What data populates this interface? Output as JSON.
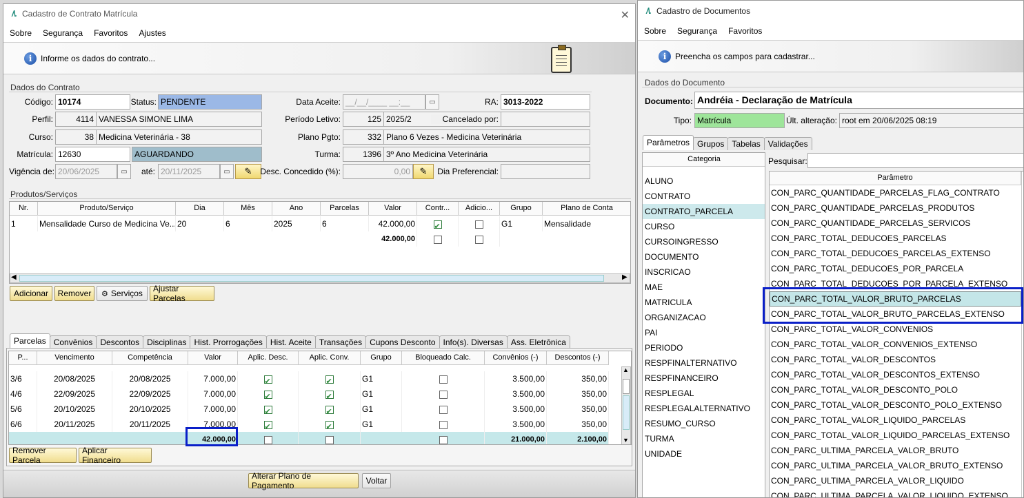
{
  "left_window": {
    "title": "Cadastro de Contrato Matrícula",
    "menu": [
      "Sobre",
      "Segurança",
      "Favoritos",
      "Ajustes"
    ],
    "banner_text": "Informe os dados do contrato...",
    "section_contract": "Dados do Contrato",
    "fields": {
      "codigo_label": "Código:",
      "codigo": "10174",
      "status_label": "Status:",
      "status": "PENDENTE",
      "data_aceite_label": "Data Aceite:",
      "data_aceite": "__/__/____ __:__",
      "ra_label": "RA:",
      "ra": "3013-2022",
      "perfil_label": "Perfil:",
      "perfil_id": "4114",
      "perfil_nome": "VANESSA SIMONE LIMA",
      "periodo_label": "Período Letivo:",
      "periodo_id": "125",
      "periodo": "2025/2",
      "cancelado_label": "Cancelado por:",
      "cancelado": "",
      "curso_label": "Curso:",
      "curso_id": "38",
      "curso_nome": "Medicina Veterinária - 38",
      "plano_label": "Plano Pgto:",
      "plano_id": "332",
      "plano_nome": "Plano 6 Vezes - Medicina Veterinária",
      "matricula_label": "Matrícula:",
      "matricula": "12630",
      "matricula_status": "AGUARDANDO",
      "turma_label": "Turma:",
      "turma_id": "1396",
      "turma_nome": "3º Ano Medicina Veterinária",
      "vigencia_label": "Vigência de:",
      "vigencia_de": "20/06/2025",
      "ate_label": "até:",
      "vigencia_ate": "20/11/2025",
      "desc_label": "Desc. Concedido (%):",
      "desc_value": "0,00",
      "dia_pref_label": "Dia Preferencial:",
      "dia_pref": ""
    },
    "section_products": "Produtos/Serviços",
    "products_headers": [
      "Nr.",
      "Produto/Serviço",
      "Dia",
      "Mês",
      "Ano",
      "Parcelas",
      "Valor",
      "Contr...",
      "Adicio...",
      "Grupo",
      "Plano de Conta"
    ],
    "products_rows": [
      {
        "nr": "1",
        "produto": "Mensalidade Curso de Medicina Ve...",
        "dia": "20",
        "mes": "6",
        "ano": "2025",
        "parcelas": "6",
        "valor": "42.000,00",
        "grupo": "G1",
        "plano": "Mensalidade"
      }
    ],
    "products_total": "42.000,00",
    "product_buttons": [
      "Adicionar",
      "Remover",
      "Serviços",
      "Ajustar Parcelas"
    ],
    "tabs": [
      "Parcelas",
      "Convênios",
      "Descontos",
      "Disciplinas",
      "Hist. Prorrogações",
      "Hist. Aceite",
      "Transações",
      "Cupons Desconto",
      "Info(s). Diversas",
      "Ass. Eletrônica"
    ],
    "parcelas_headers": [
      "P...",
      "Vencimento",
      "Competência",
      "Valor",
      "Aplic. Desc.",
      "Aplic. Conv.",
      "Grupo",
      "Bloqueado Calc.",
      "Convênios (-)",
      "Descontos (-)"
    ],
    "parcelas_rows": [
      {
        "p": "3/6",
        "venc": "20/08/2025",
        "comp": "20/08/2025",
        "valor": "7.000,00",
        "grupo": "G1",
        "conv": "3.500,00",
        "desc": "350,00"
      },
      {
        "p": "4/6",
        "venc": "22/09/2025",
        "comp": "22/09/2025",
        "valor": "7.000,00",
        "grupo": "G1",
        "conv": "3.500,00",
        "desc": "350,00"
      },
      {
        "p": "5/6",
        "venc": "20/10/2025",
        "comp": "20/10/2025",
        "valor": "7.000,00",
        "grupo": "G1",
        "conv": "3.500,00",
        "desc": "350,00"
      },
      {
        "p": "6/6",
        "venc": "20/11/2025",
        "comp": "20/11/2025",
        "valor": "7.000,00",
        "grupo": "G1",
        "conv": "3.500,00",
        "desc": "350,00"
      }
    ],
    "parcelas_totals": {
      "valor": "42.000,00",
      "conv": "21.000,00",
      "desc": "2.100,00"
    },
    "parcela_buttons": [
      "Remover Parcela",
      "Aplicar Financeiro"
    ],
    "footer_buttons": [
      "Alterar Plano de Pagamento",
      "Voltar"
    ]
  },
  "right_window": {
    "title": "Cadastro de Documentos",
    "menu": [
      "Sobre",
      "Segurança",
      "Favoritos"
    ],
    "banner_text": "Preencha os campos para cadastrar...",
    "section": "Dados do Documento",
    "documento_label": "Documento:",
    "documento": "Andréia - Declaração de Matrícula",
    "tipo_label": "Tipo:",
    "tipo": "Matrícula",
    "ult_alt_label": "Últ. alteração:",
    "ult_alt": "root em 20/06/2025 08:19",
    "tabs": [
      "Parâmetros",
      "Grupos",
      "Tabelas",
      "Validações"
    ],
    "categoria_header": "Categoria",
    "categorias": [
      "ALUNO",
      "CONTRATO",
      "CONTRATO_PARCELA",
      "CURSO",
      "CURSOINGRESSO",
      "DOCUMENTO",
      "INSCRICAO",
      "MAE",
      "MATRICULA",
      "ORGANIZACAO",
      "PAI",
      "PERIODO",
      "RESPFINALTERNATIVO",
      "RESPFINANCEIRO",
      "RESPLEGAL",
      "RESPLEGALALTERNATIVO",
      "RESUMO_CURSO",
      "TURMA",
      "UNIDADE"
    ],
    "selected_categoria": "CONTRATO_PARCELA",
    "pesquisar_label": "Pesquisar:",
    "parametro_header": "Parâmetro",
    "parametros": [
      "CON_PARC_QUANTIDADE_PARCELAS_FLAG_CONTRATO",
      "CON_PARC_QUANTIDADE_PARCELAS_PRODUTOS",
      "CON_PARC_QUANTIDADE_PARCELAS_SERVICOS",
      "CON_PARC_TOTAL_DEDUCOES_PARCELAS",
      "CON_PARC_TOTAL_DEDUCOES_PARCELAS_EXTENSO",
      "CON_PARC_TOTAL_DEDUCOES_POR_PARCELA",
      "CON_PARC_TOTAL_DEDUCOES_POR_PARCELA_EXTENSO",
      "CON_PARC_TOTAL_VALOR_BRUTO_PARCELAS",
      "CON_PARC_TOTAL_VALOR_BRUTO_PARCELAS_EXTENSO",
      "CON_PARC_TOTAL_VALOR_CONVENIOS",
      "CON_PARC_TOTAL_VALOR_CONVENIOS_EXTENSO",
      "CON_PARC_TOTAL_VALOR_DESCONTOS",
      "CON_PARC_TOTAL_VALOR_DESCONTOS_EXTENSO",
      "CON_PARC_TOTAL_VALOR_DESCONTO_POLO",
      "CON_PARC_TOTAL_VALOR_DESCONTO_POLO_EXTENSO",
      "CON_PARC_TOTAL_VALOR_LIQUIDO_PARCELAS",
      "CON_PARC_TOTAL_VALOR_LIQUIDO_PARCELAS_EXTENSO",
      "CON_PARC_ULTIMA_PARCELA_VALOR_BRUTO",
      "CON_PARC_ULTIMA_PARCELA_VALOR_BRUTO_EXTENSO",
      "CON_PARC_ULTIMA_PARCELA_VALOR_LIQUIDO",
      "CON_PARC_ULTIMA_PARCELA_VALOR_LIQUIDO_EXTENSO"
    ],
    "selected_parametro": "CON_PARC_TOTAL_VALOR_BRUTO_PARCELAS"
  },
  "colors": {
    "highlight_box": "#0a1fc8",
    "status_blue": "#9bb8e6",
    "tipo_green": "#9ee59a",
    "selected_row": "#c4e6e8",
    "totals_row": "#c5e8ea"
  }
}
